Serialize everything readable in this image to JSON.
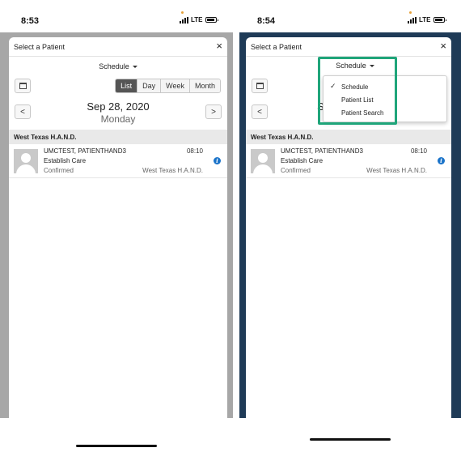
{
  "left": {
    "status": {
      "time": "8:53",
      "network": "LTE"
    },
    "modal": {
      "title": "Select a Patient",
      "close": "×",
      "view_selector": "Schedule",
      "view_tabs": [
        "List",
        "Day",
        "Week",
        "Month"
      ],
      "active_tab": "List",
      "date": "Sep 28, 2020",
      "weekday": "Monday",
      "prev": "<",
      "next": ">",
      "group": "West Texas H.A.N.D.",
      "appointment": {
        "patient": "UMCTEST, PATIENTHAND3",
        "time": "08:10",
        "type": "Establish Care",
        "status": "Confirmed",
        "location": "West Texas H.A.N.D."
      }
    }
  },
  "right": {
    "status": {
      "time": "8:54",
      "network": "LTE"
    },
    "modal": {
      "title": "Select a Patient",
      "close": "×",
      "view_selector": "Schedule",
      "partial_date_text": "Se",
      "weekday": "Monday",
      "prev": "<",
      "group": "West Texas H.A.N.D.",
      "appointment": {
        "patient": "UMCTEST, PATIENTHAND3",
        "time": "08:10",
        "type": "Establish Care",
        "status": "Confirmed",
        "location": "West Texas H.A.N.D."
      },
      "dropdown": {
        "items": [
          "Schedule",
          "Patient List",
          "Patient Search"
        ],
        "checked": "Schedule",
        "check_glyph": "✓"
      }
    }
  },
  "colors": {
    "highlight": "#1fa57a",
    "accent_blue": "#1a73c9",
    "active_tab_bg": "#555555"
  },
  "icons": {
    "info": "info-icon",
    "calendar": "calendar-icon",
    "avatar": "avatar-placeholder-icon"
  },
  "info_glyph": "i"
}
